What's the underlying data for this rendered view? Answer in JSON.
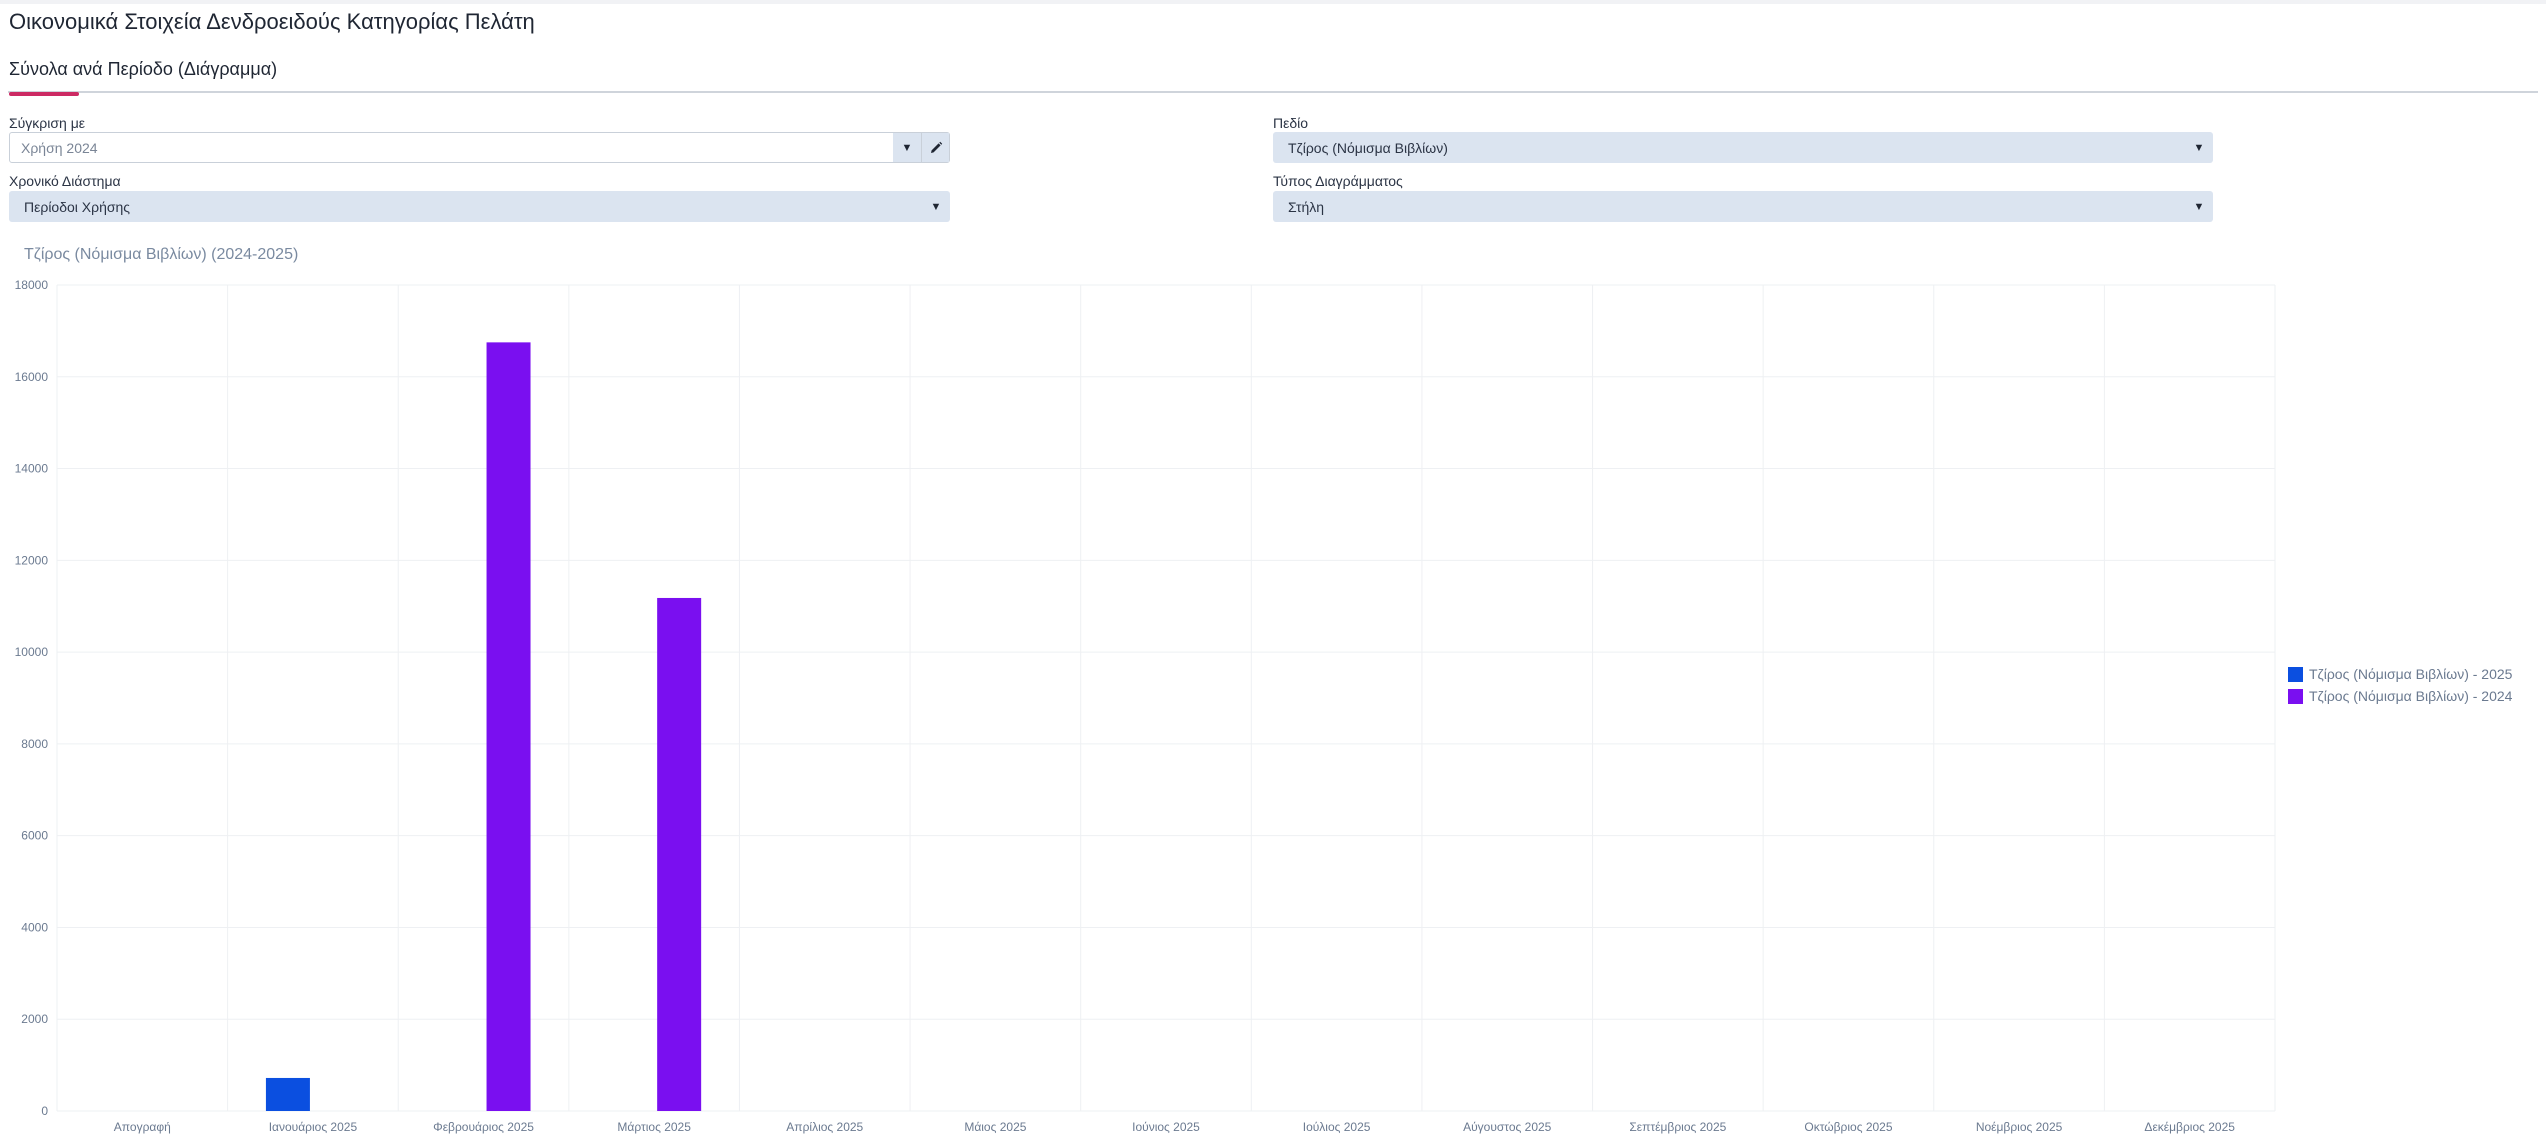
{
  "page": {
    "title": "Οικονομικά Στοιχεία Δενδροειδούς Κατηγορίας Πελάτη"
  },
  "tabs": [
    {
      "label": "Σύνολα ανά Περίοδο (Διάγραμμα)",
      "active": true
    }
  ],
  "filters": {
    "compare_with": {
      "label": "Σύγκριση με",
      "value": "Χρήση 2024"
    },
    "field": {
      "label": "Πεδίο",
      "value": "Τζίρος (Νόμισμα Βιβλίων)"
    },
    "time_span": {
      "label": "Χρονικό Διάστημα",
      "value": "Περίοδοι Χρήσης"
    },
    "chart_type": {
      "label": "Τύπος Διαγράμματος",
      "value": "Στήλη"
    }
  },
  "colors": {
    "accent": "#cc2a63",
    "series_2025": "#0b4fe0",
    "series_2024": "#7a0ff0",
    "field_bg": "#dbe4f0"
  },
  "icons": {
    "dropdown": "chevron-down-icon",
    "edit": "pencil-icon"
  },
  "chart_data": {
    "type": "bar",
    "title": "Τζίρος (Νόμισμα Βιβλίων) (2024-2025)",
    "categories": [
      "Απογραφή",
      "Ιανουάριος 2025",
      "Φεβρουάριος 2025",
      "Μάρτιος 2025",
      "Απρίλιος 2025",
      "Μάιος 2025",
      "Ιούνιος 2025",
      "Ιούλιος 2025",
      "Αύγουστος 2025",
      "Σεπτέμβριος 2025",
      "Οκτώβριος 2025",
      "Νοέμβριος 2025",
      "Δεκέμβριος 2025"
    ],
    "series": [
      {
        "name": "Τζίρος (Νόμισμα Βιβλίων) - 2025",
        "color": "#0b4fe0",
        "values": [
          0,
          720,
          0,
          0,
          0,
          0,
          0,
          0,
          0,
          0,
          0,
          0,
          0
        ]
      },
      {
        "name": "Τζίρος (Νόμισμα Βιβλίων) - 2024",
        "color": "#7a0ff0",
        "values": [
          0,
          0,
          16750,
          11180,
          0,
          0,
          0,
          0,
          0,
          0,
          0,
          0,
          0
        ]
      }
    ],
    "ylim": [
      0,
      18000
    ],
    "yticks": [
      "0",
      "2000",
      "4000",
      "6000",
      "8000",
      "10000",
      "12000",
      "14000",
      "16000",
      "18000"
    ],
    "grid": true,
    "legend_position": "right"
  }
}
